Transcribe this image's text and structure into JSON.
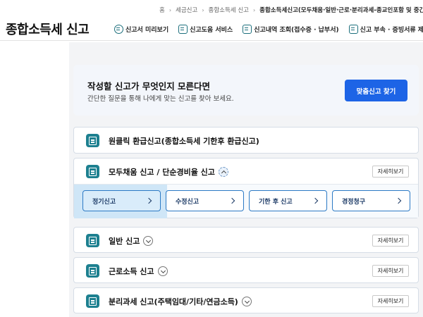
{
  "breadcrumb": [
    "홈",
    "세금신고",
    "종합소득세 신고",
    "종합소득세신고(모두채움·일반·근로·분리과세-종교인포함 및 중간"
  ],
  "page_title": "종합소득세 신고",
  "quick_links": [
    {
      "label": "신고서 미리보기",
      "icon": "document-search-icon"
    },
    {
      "label": "신고도움 서비스",
      "icon": "monitor-help-icon"
    },
    {
      "label": "신고내역 조회(접수증 · 납부서)",
      "icon": "list-doc-icon"
    },
    {
      "label": "신고 부속 · 증빙서류 제",
      "icon": "upload-doc-icon"
    }
  ],
  "finder": {
    "title": "작성할 신고가 무엇인지 모른다면",
    "desc": "간단한 질문을 통해 나에게 맞는 신고를 찾아 보세요.",
    "button": "맞춤신고 찾기"
  },
  "items": [
    {
      "label": "원클릭 환급신고(종합소득세 기한후 환급신고)"
    },
    {
      "label": "모두채움 신고 / 단순경비율 신고",
      "detail": "자세히보기"
    },
    {
      "label": "일반 신고",
      "detail": "자세히보기"
    },
    {
      "label": "근로소득 신고",
      "detail": "자세히보기"
    },
    {
      "label": "분리과세 신고(주택임대/기타/연금소득)",
      "detail": "자세히보기"
    }
  ],
  "sub_buttons": [
    "정기신고",
    "수정신고",
    "기한 후 신고",
    "경정청구"
  ],
  "colors": {
    "primary": "#1d64e6",
    "icon_teal": "#1d8090",
    "sub_border": "#2c7ac5",
    "active_bg": "#cfe6f7"
  }
}
